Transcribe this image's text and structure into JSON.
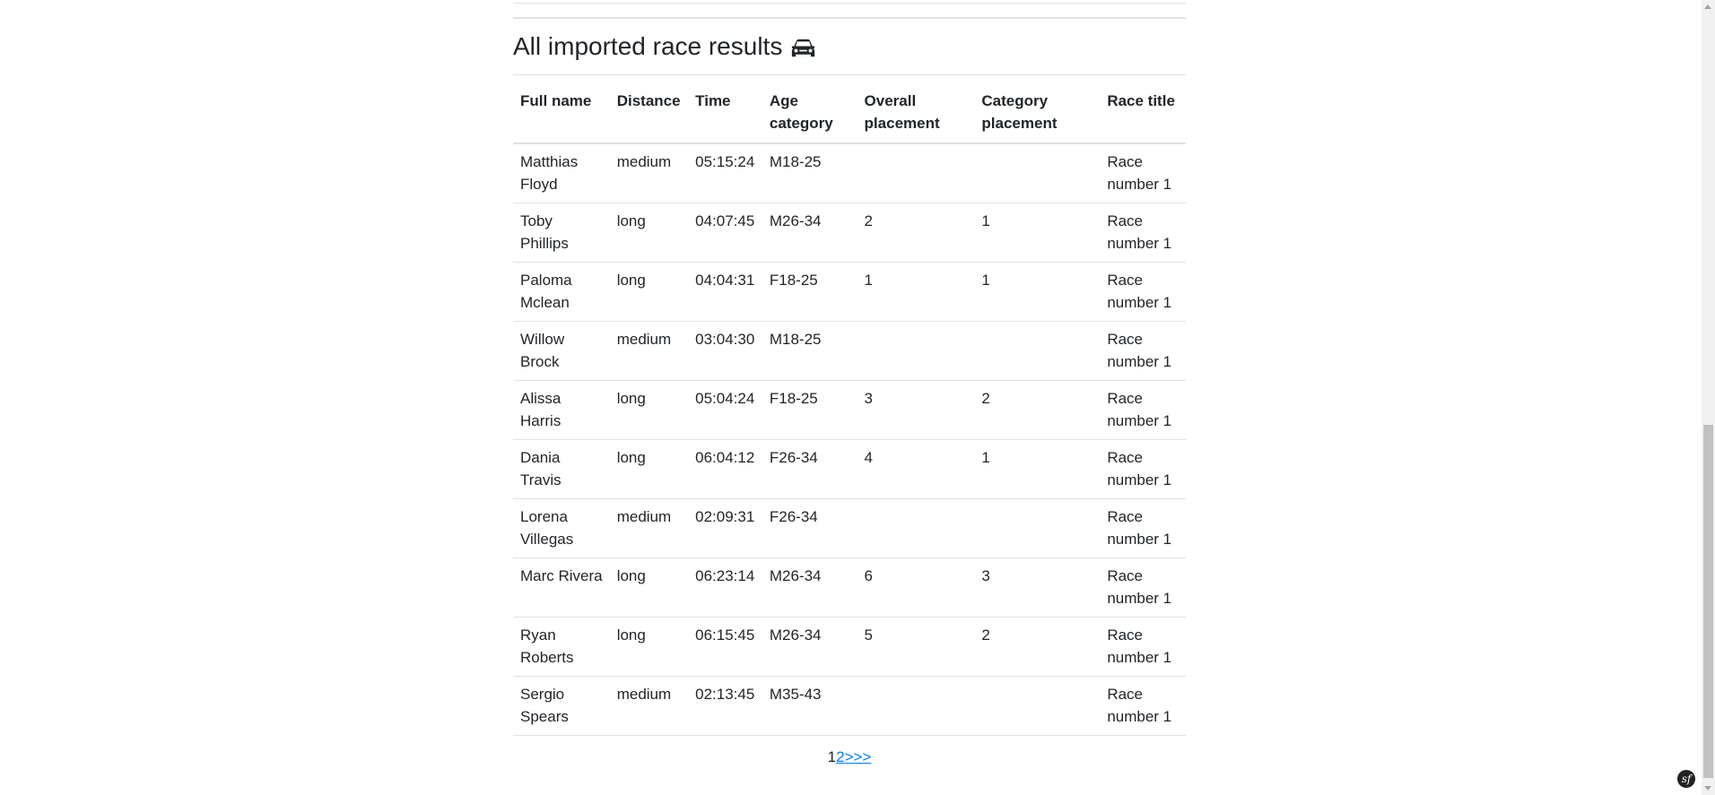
{
  "heading": {
    "title": "All imported race results",
    "icon": "car-icon"
  },
  "table": {
    "columns": [
      "Full name",
      "Distance",
      "Time",
      "Age category",
      "Overall placement",
      "Category placement",
      "Race title"
    ],
    "rows": [
      {
        "full_name": "Matthias Floyd",
        "distance": "medium",
        "time": "05:15:24",
        "age_category": "M18-25",
        "overall": "",
        "category": "",
        "race_title": "Race number 1"
      },
      {
        "full_name": "Toby Phillips",
        "distance": "long",
        "time": "04:07:45",
        "age_category": "M26-34",
        "overall": "2",
        "category": "1",
        "race_title": "Race number 1"
      },
      {
        "full_name": "Paloma Mclean",
        "distance": "long",
        "time": "04:04:31",
        "age_category": "F18-25",
        "overall": "1",
        "category": "1",
        "race_title": "Race number 1"
      },
      {
        "full_name": "Willow Brock",
        "distance": "medium",
        "time": "03:04:30",
        "age_category": "M18-25",
        "overall": "",
        "category": "",
        "race_title": "Race number 1"
      },
      {
        "full_name": "Alissa Harris",
        "distance": "long",
        "time": "05:04:24",
        "age_category": "F18-25",
        "overall": "3",
        "category": "2",
        "race_title": "Race number 1"
      },
      {
        "full_name": "Dania Travis",
        "distance": "long",
        "time": "06:04:12",
        "age_category": "F26-34",
        "overall": "4",
        "category": "1",
        "race_title": "Race number 1"
      },
      {
        "full_name": "Lorena Villegas",
        "distance": "medium",
        "time": "02:09:31",
        "age_category": "F26-34",
        "overall": "",
        "category": "",
        "race_title": "Race number 1"
      },
      {
        "full_name": "Marc Rivera",
        "distance": "long",
        "time": "06:23:14",
        "age_category": "M26-34",
        "overall": "6",
        "category": "3",
        "race_title": "Race number 1"
      },
      {
        "full_name": "Ryan Roberts",
        "distance": "long",
        "time": "06:15:45",
        "age_category": "M26-34",
        "overall": "5",
        "category": "2",
        "race_title": "Race number 1"
      },
      {
        "full_name": "Sergio Spears",
        "distance": "medium",
        "time": "02:13:45",
        "age_category": "M35-43",
        "overall": "",
        "category": "",
        "race_title": "Race number 1"
      }
    ]
  },
  "pagination": {
    "current": "1",
    "next_page": "2",
    "next": ">",
    "last": ">>"
  },
  "toolbar": {
    "badge": "sf"
  },
  "colors": {
    "link": "#007bff",
    "text": "#212529",
    "border": "#dee2e6"
  }
}
